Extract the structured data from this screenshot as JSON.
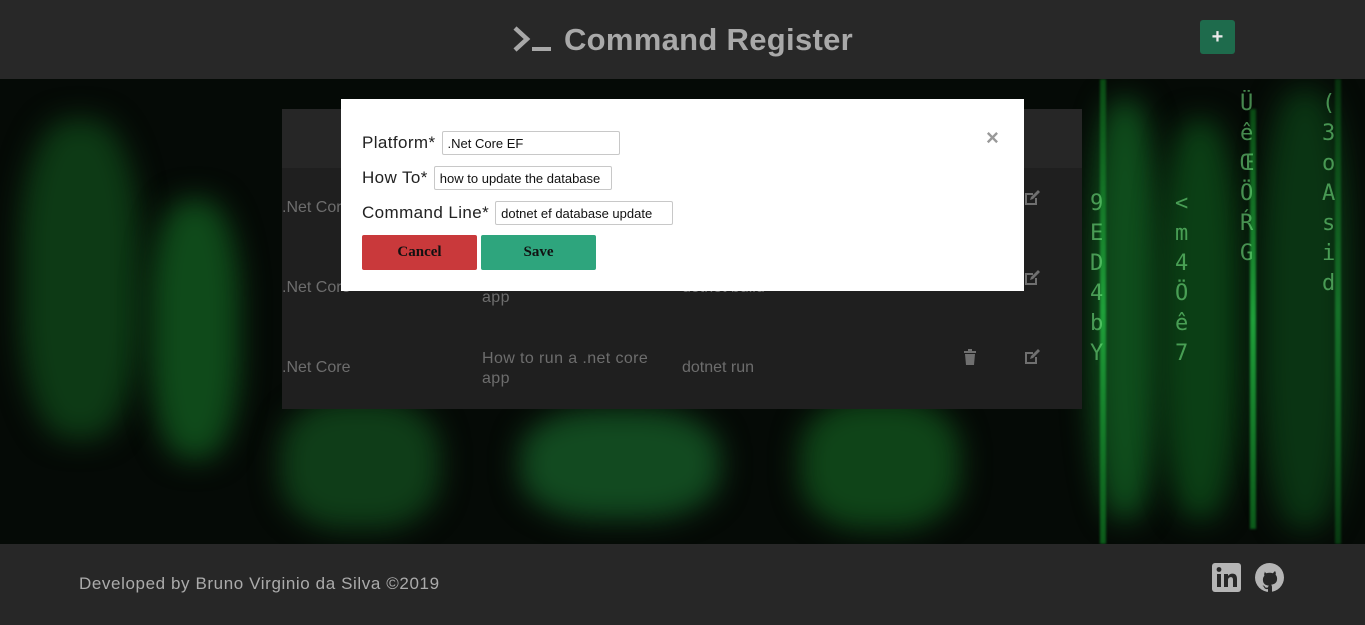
{
  "header": {
    "title": "Command Register",
    "add_label": "+"
  },
  "table": {
    "rows": [
      {
        "platform": ".Net Core",
        "howto": "",
        "command": ""
      },
      {
        "platform": ".Net Core",
        "howto": "app",
        "command": "dotnet build"
      },
      {
        "platform": ".Net Core",
        "howto": "How to run a .net core app",
        "command": "dotnet run"
      }
    ]
  },
  "modal": {
    "platform_label": "Platform*",
    "platform_value": ".Net Core EF",
    "howto_label": "How To*",
    "howto_value": "how to update the database",
    "command_label": "Command Line*",
    "command_value": "dotnet ef database update",
    "close_label": "×",
    "cancel_label": "Cancel",
    "save_label": "Save"
  },
  "footer": {
    "credit": "Developed by Bruno Virginio da Silva ©2019"
  },
  "colors": {
    "accent_green": "#1e6b4c",
    "save_green": "#2ea57d",
    "cancel_red": "#c9393b"
  },
  "icons": [
    "terminal-icon",
    "close-icon",
    "trash-icon",
    "edit-icon",
    "linkedin-icon",
    "github-icon"
  ]
}
